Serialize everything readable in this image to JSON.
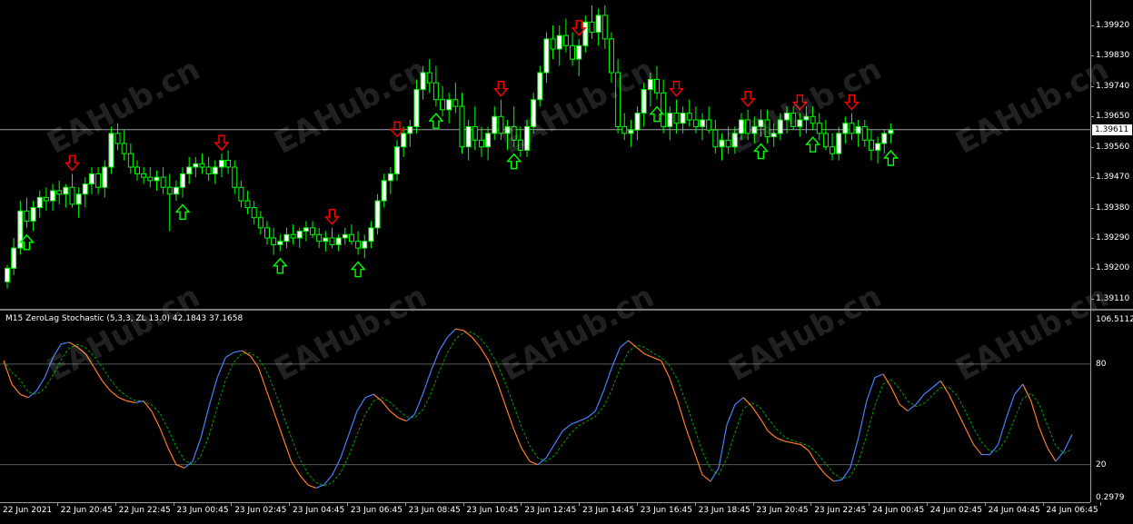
{
  "price_axis": {
    "labels": [
      "1.39920",
      "1.39830",
      "1.39740",
      "1.39650",
      "1.39560",
      "1.39470",
      "1.39380",
      "1.39290",
      "1.39200",
      "1.39110"
    ],
    "current_price": "1.39611"
  },
  "time_axis": {
    "labels": [
      "22 Jun 2021",
      "22 Jun 20:45",
      "22 Jun 22:45",
      "23 Jun 00:45",
      "23 Jun 02:45",
      "23 Jun 04:45",
      "23 Jun 06:45",
      "23 Jun 08:45",
      "23 Jun 10:45",
      "23 Jun 12:45",
      "23 Jun 14:45",
      "23 Jun 16:45",
      "23 Jun 18:45",
      "23 Jun 20:45",
      "23 Jun 22:45",
      "24 Jun 00:45",
      "24 Jun 02:45",
      "24 Jun 04:45",
      "24 Jun 06:45"
    ]
  },
  "indicator": {
    "title": "M15 ZeroLag Stochastic (5,3,3, ZL 13.0) 42.1843 37.1658",
    "scale_labels": [
      "106.5112",
      "80",
      "20",
      "0.2979"
    ],
    "levels": [
      80,
      20
    ]
  },
  "watermark": "EAHub.cn",
  "colors": {
    "background": "#000000",
    "bull_candle": "#ffffff",
    "bear_candle": "#000000",
    "candle_outline": "#00ff00",
    "up_arrow": "#00ff00",
    "down_arrow": "#ff0000",
    "stoch_main_up": "#4a7fff",
    "stoch_main_down": "#ff7a2a",
    "stoch_signal": "#00a000"
  },
  "chart_data": {
    "type": "candlestick",
    "symbol_timeframe": "M15",
    "ylim": [
      1.3908,
      1.3999
    ],
    "candles": [
      [
        1.3916,
        1.3921,
        1.3914,
        1.392
      ],
      [
        1.392,
        1.3929,
        1.3918,
        1.3926
      ],
      [
        1.3926,
        1.394,
        1.3924,
        1.3937
      ],
      [
        1.3937,
        1.3941,
        1.3932,
        1.3934
      ],
      [
        1.3934,
        1.394,
        1.3931,
        1.3938
      ],
      [
        1.3938,
        1.3943,
        1.3935,
        1.3941
      ],
      [
        1.3941,
        1.3944,
        1.3937,
        1.394
      ],
      [
        1.394,
        1.3945,
        1.3937,
        1.3943
      ],
      [
        1.3943,
        1.3946,
        1.3939,
        1.3942
      ],
      [
        1.3942,
        1.3945,
        1.3938,
        1.3944
      ],
      [
        1.3944,
        1.3948,
        1.3938,
        1.3939
      ],
      [
        1.3939,
        1.3944,
        1.3935,
        1.3942
      ],
      [
        1.3942,
        1.3947,
        1.3938,
        1.3945
      ],
      [
        1.3945,
        1.395,
        1.3942,
        1.3948
      ],
      [
        1.3948,
        1.395,
        1.3942,
        1.3944
      ],
      [
        1.3944,
        1.3952,
        1.3941,
        1.395
      ],
      [
        1.395,
        1.3962,
        1.3948,
        1.396
      ],
      [
        1.396,
        1.3963,
        1.3955,
        1.3957
      ],
      [
        1.3957,
        1.3961,
        1.3952,
        1.3954
      ],
      [
        1.3954,
        1.3957,
        1.3948,
        1.395
      ],
      [
        1.395,
        1.3952,
        1.3946,
        1.3948
      ],
      [
        1.3948,
        1.395,
        1.3945,
        1.3947
      ],
      [
        1.3947,
        1.395,
        1.3944,
        1.3946
      ],
      [
        1.3946,
        1.3949,
        1.3943,
        1.3947
      ],
      [
        1.3947,
        1.395,
        1.3942,
        1.3944
      ],
      [
        1.3944,
        1.3948,
        1.3931,
        1.3942
      ],
      [
        1.3942,
        1.3946,
        1.394,
        1.3944
      ],
      [
        1.3944,
        1.395,
        1.3941,
        1.3948
      ],
      [
        1.3948,
        1.3953,
        1.3945,
        1.395
      ],
      [
        1.395,
        1.3953,
        1.3947,
        1.3951
      ],
      [
        1.3951,
        1.3954,
        1.3948,
        1.395
      ],
      [
        1.395,
        1.3953,
        1.3946,
        1.3948
      ],
      [
        1.3948,
        1.3952,
        1.3945,
        1.395
      ],
      [
        1.395,
        1.3954,
        1.3947,
        1.3952
      ],
      [
        1.3952,
        1.3955,
        1.3948,
        1.395
      ],
      [
        1.395,
        1.3952,
        1.3942,
        1.3944
      ],
      [
        1.3944,
        1.3946,
        1.3938,
        1.394
      ],
      [
        1.394,
        1.3943,
        1.3936,
        1.3938
      ],
      [
        1.3938,
        1.394,
        1.3933,
        1.3935
      ],
      [
        1.3935,
        1.3937,
        1.393,
        1.3932
      ],
      [
        1.3932,
        1.3934,
        1.3927,
        1.3929
      ],
      [
        1.3929,
        1.3932,
        1.3924,
        1.3927
      ],
      [
        1.3927,
        1.393,
        1.3925,
        1.3928
      ],
      [
        1.3928,
        1.3932,
        1.3926,
        1.393
      ],
      [
        1.393,
        1.3933,
        1.3927,
        1.3929
      ],
      [
        1.3929,
        1.3932,
        1.3926,
        1.3931
      ],
      [
        1.3931,
        1.3934,
        1.3928,
        1.3932
      ],
      [
        1.3932,
        1.3934,
        1.3929,
        1.393
      ],
      [
        1.393,
        1.3932,
        1.3926,
        1.3928
      ],
      [
        1.3928,
        1.3931,
        1.3925,
        1.3929
      ],
      [
        1.3929,
        1.3932,
        1.3926,
        1.3927
      ],
      [
        1.3927,
        1.393,
        1.3925,
        1.3929
      ],
      [
        1.3929,
        1.3932,
        1.3927,
        1.393
      ],
      [
        1.393,
        1.3933,
        1.3927,
        1.3928
      ],
      [
        1.3928,
        1.3931,
        1.3924,
        1.3926
      ],
      [
        1.3926,
        1.393,
        1.3923,
        1.3928
      ],
      [
        1.3928,
        1.3934,
        1.3926,
        1.3932
      ],
      [
        1.3932,
        1.3942,
        1.393,
        1.394
      ],
      [
        1.394,
        1.3948,
        1.3938,
        1.3946
      ],
      [
        1.3946,
        1.395,
        1.3942,
        1.3948
      ],
      [
        1.3948,
        1.3958,
        1.3946,
        1.3956
      ],
      [
        1.3956,
        1.3962,
        1.3953,
        1.396
      ],
      [
        1.396,
        1.3964,
        1.3956,
        1.3962
      ],
      [
        1.3962,
        1.3976,
        1.396,
        1.3973
      ],
      [
        1.3973,
        1.398,
        1.397,
        1.3978
      ],
      [
        1.3978,
        1.3982,
        1.3972,
        1.3975
      ],
      [
        1.3975,
        1.398,
        1.3968,
        1.397
      ],
      [
        1.397,
        1.3974,
        1.3965,
        1.3967
      ],
      [
        1.3967,
        1.3972,
        1.3963,
        1.397
      ],
      [
        1.397,
        1.3975,
        1.3966,
        1.3968
      ],
      [
        1.3968,
        1.3972,
        1.3954,
        1.3956
      ],
      [
        1.3956,
        1.3964,
        1.3952,
        1.3962
      ],
      [
        1.3962,
        1.3968,
        1.3955,
        1.3958
      ],
      [
        1.3958,
        1.3962,
        1.3953,
        1.3956
      ],
      [
        1.3956,
        1.3962,
        1.3952,
        1.396
      ],
      [
        1.396,
        1.3968,
        1.3958,
        1.3965
      ],
      [
        1.3965,
        1.397,
        1.3958,
        1.396
      ],
      [
        1.396,
        1.3964,
        1.3955,
        1.3962
      ],
      [
        1.3962,
        1.3968,
        1.3956,
        1.3958
      ],
      [
        1.3958,
        1.3962,
        1.3953,
        1.3955
      ],
      [
        1.3955,
        1.3964,
        1.3953,
        1.3962
      ],
      [
        1.3962,
        1.3972,
        1.396,
        1.397
      ],
      [
        1.397,
        1.398,
        1.3968,
        1.3978
      ],
      [
        1.3978,
        1.399,
        1.3975,
        1.3988
      ],
      [
        1.3988,
        1.3992,
        1.3982,
        1.3985
      ],
      [
        1.3985,
        1.3992,
        1.398,
        1.3989
      ],
      [
        1.3989,
        1.3994,
        1.3984,
        1.3986
      ],
      [
        1.3986,
        1.399,
        1.398,
        1.3982
      ],
      [
        1.3982,
        1.3988,
        1.3977,
        1.3986
      ],
      [
        1.3986,
        1.3995,
        1.3984,
        1.3993
      ],
      [
        1.3993,
        1.3998,
        1.3988,
        1.399
      ],
      [
        1.399,
        1.3997,
        1.3986,
        1.3995
      ],
      [
        1.3995,
        1.3998,
        1.3985,
        1.3988
      ],
      [
        1.3988,
        1.399,
        1.3975,
        1.3978
      ],
      [
        1.3978,
        1.3982,
        1.396,
        1.3962
      ],
      [
        1.3962,
        1.3966,
        1.3958,
        1.396
      ],
      [
        1.396,
        1.3964,
        1.3956,
        1.3961
      ],
      [
        1.3961,
        1.3968,
        1.3958,
        1.3966
      ],
      [
        1.3966,
        1.3975,
        1.3962,
        1.3973
      ],
      [
        1.3973,
        1.3978,
        1.3968,
        1.3976
      ],
      [
        1.3976,
        1.398,
        1.397,
        1.3972
      ],
      [
        1.3972,
        1.3976,
        1.396,
        1.3962
      ],
      [
        1.3962,
        1.3968,
        1.3958,
        1.3966
      ],
      [
        1.3966,
        1.397,
        1.396,
        1.3963
      ],
      [
        1.3963,
        1.3968,
        1.396,
        1.3966
      ],
      [
        1.3966,
        1.397,
        1.3962,
        1.3964
      ],
      [
        1.3964,
        1.3968,
        1.396,
        1.3962
      ],
      [
        1.3962,
        1.3966,
        1.3958,
        1.3964
      ],
      [
        1.3964,
        1.3968,
        1.396,
        1.3961
      ],
      [
        1.3961,
        1.3964,
        1.3954,
        1.3956
      ],
      [
        1.3956,
        1.396,
        1.3952,
        1.3958
      ],
      [
        1.3958,
        1.3962,
        1.3954,
        1.3956
      ],
      [
        1.3956,
        1.3962,
        1.3954,
        1.396
      ],
      [
        1.396,
        1.3966,
        1.3958,
        1.3964
      ],
      [
        1.3964,
        1.3967,
        1.3958,
        1.396
      ],
      [
        1.396,
        1.3965,
        1.3957,
        1.3962
      ],
      [
        1.3962,
        1.3967,
        1.3959,
        1.3964
      ],
      [
        1.3964,
        1.3967,
        1.3957,
        1.3959
      ],
      [
        1.3959,
        1.3963,
        1.3956,
        1.396
      ],
      [
        1.396,
        1.3966,
        1.3958,
        1.3964
      ],
      [
        1.3964,
        1.3968,
        1.396,
        1.3966
      ],
      [
        1.3966,
        1.3968,
        1.3961,
        1.3962
      ],
      [
        1.3962,
        1.3966,
        1.3959,
        1.3964
      ],
      [
        1.3964,
        1.3968,
        1.396,
        1.3965
      ],
      [
        1.3965,
        1.3968,
        1.3961,
        1.3963
      ],
      [
        1.3963,
        1.3966,
        1.3958,
        1.396
      ],
      [
        1.396,
        1.3964,
        1.3955,
        1.3956
      ],
      [
        1.3956,
        1.396,
        1.3952,
        1.3954
      ],
      [
        1.3954,
        1.3962,
        1.3952,
        1.396
      ],
      [
        1.396,
        1.3965,
        1.3957,
        1.3963
      ],
      [
        1.3963,
        1.3966,
        1.3958,
        1.396
      ],
      [
        1.396,
        1.3964,
        1.3956,
        1.3962
      ],
      [
        1.3962,
        1.3964,
        1.3956,
        1.3958
      ],
      [
        1.3958,
        1.3961,
        1.3952,
        1.3955
      ],
      [
        1.3955,
        1.3959,
        1.3951,
        1.3957
      ],
      [
        1.3957,
        1.3961,
        1.3954,
        1.396
      ],
      [
        1.396,
        1.3963,
        1.3957,
        1.3961
      ]
    ],
    "up_arrow_bars": [
      3,
      27,
      42,
      54,
      66,
      78,
      100,
      116,
      124,
      136,
      148,
      153,
      161
    ],
    "down_arrow_bars": [
      10,
      33,
      50,
      60,
      76,
      88,
      103,
      114,
      122,
      130,
      144,
      156
    ]
  },
  "oscillator_data": {
    "main": [
      82,
      68,
      62,
      60,
      64,
      72,
      84,
      92,
      93,
      90,
      86,
      78,
      70,
      64,
      60,
      58,
      57,
      58,
      52,
      42,
      30,
      20,
      18,
      22,
      36,
      55,
      72,
      84,
      87,
      88,
      85,
      78,
      64,
      50,
      36,
      22,
      14,
      8,
      6,
      8,
      14,
      24,
      38,
      52,
      60,
      62,
      58,
      52,
      48,
      46,
      50,
      62,
      76,
      88,
      96,
      101,
      100,
      96,
      90,
      82,
      70,
      56,
      42,
      30,
      22,
      20,
      24,
      32,
      40,
      44,
      46,
      48,
      52,
      64,
      78,
      90,
      94,
      90,
      86,
      84,
      82,
      72,
      58,
      42,
      28,
      14,
      10,
      18,
      44,
      56,
      60,
      55,
      48,
      40,
      36,
      34,
      33,
      32,
      28,
      20,
      14,
      10,
      11,
      18,
      36,
      58,
      72,
      74,
      66,
      56,
      52,
      56,
      62,
      66,
      70,
      62,
      52,
      42,
      32,
      26,
      26,
      32,
      48,
      62,
      68,
      58,
      42,
      30,
      22,
      28,
      38
    ]
  }
}
